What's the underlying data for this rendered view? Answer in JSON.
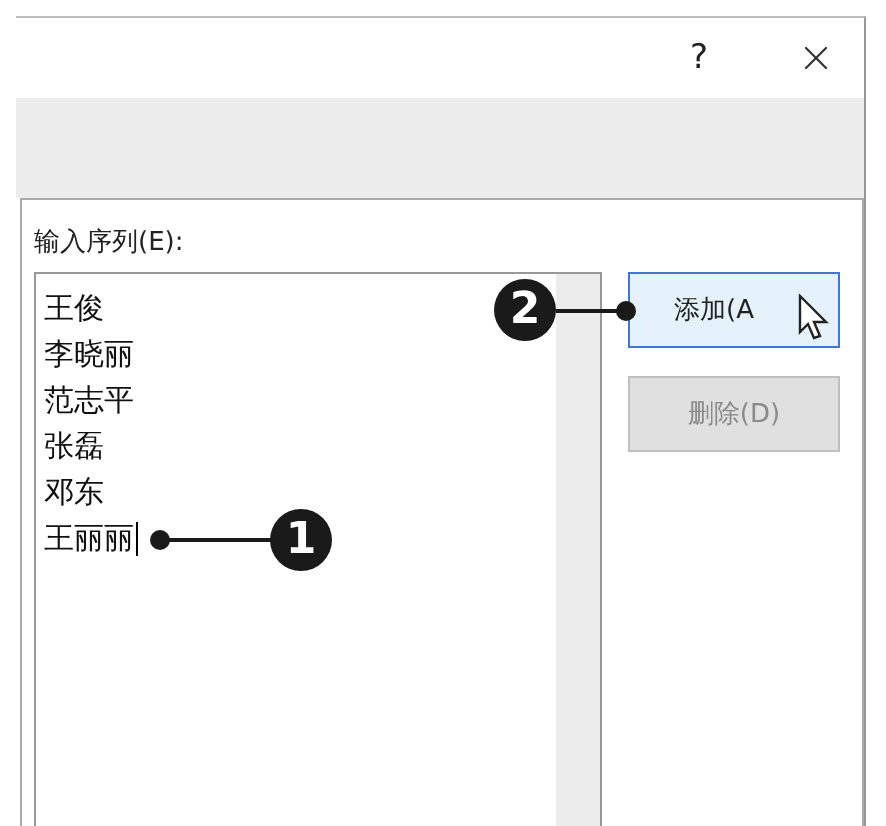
{
  "window": {
    "help": "?"
  },
  "sequence": {
    "label": "输入序列(E):",
    "entries": [
      "王俊",
      "李晓丽",
      "范志平",
      "张磊",
      "邓东",
      "王丽丽"
    ],
    "caret": true,
    "callout": "1"
  },
  "buttons": [
    {
      "label": "添加(A",
      "hovered": true,
      "disabled": false,
      "callout": "2"
    },
    {
      "label": "删除(D)",
      "hovered": false,
      "disabled": true
    }
  ]
}
